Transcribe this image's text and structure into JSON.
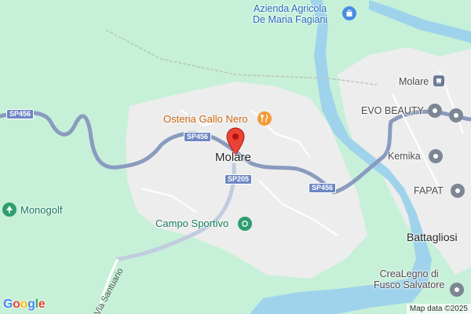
{
  "map": {
    "places": {
      "osteria": "Osteria Gallo Nero",
      "molare_center": "Molare",
      "molare_station": "Molare",
      "azienda_line1": "Azienda Agricola",
      "azienda_line2": "De Maria Fagiani",
      "evo_beauty": "EVO BEAUTY",
      "kemika": "Kemika",
      "fapat": "FAPAT",
      "battagliosi": "Battagliosi",
      "crealegno_line1": "CreaLegno di",
      "crealegno_line2": "Fusco Salvatore",
      "campo_sportivo": "Campo Sportivo",
      "monogolf": "Monogolf"
    },
    "roads": {
      "sp456_a": "SP456",
      "sp456_b": "SP456",
      "sp456_c": "SP456",
      "sp205": "SP205",
      "via_santuario": "Via Santuario"
    },
    "attribution": "Map data ©2025",
    "logo": {
      "g1": "G",
      "o1": "o",
      "o2": "o",
      "g2": "g",
      "l": "l",
      "e": "e"
    },
    "icons": {
      "restaurant": "restaurant-icon",
      "shop": "shopping-bag-icon",
      "station": "train-station-icon",
      "business": "business-pin-icon",
      "sport": "stadium-icon",
      "park": "tree-icon",
      "marker": "location-marker-icon"
    },
    "colors": {
      "land": "#c7f0d8",
      "urban": "#ededed",
      "river": "#9fd3ec",
      "road": "#8a9bbf",
      "marker": "#ea4335"
    }
  }
}
